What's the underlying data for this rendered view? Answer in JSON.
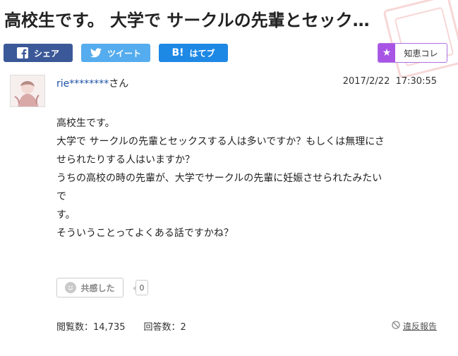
{
  "question": {
    "title": "高校生です。 大学で サークルの先輩とセック…",
    "body_lines": [
      "高校生です。",
      "大学で サークルの先輩とセックスする人は多いですか？もしくは無理にさ",
      "せられたりする人はいますか？",
      "うちの高校の時の先輩が、大学でサークルの先輩に妊娠させられたみたい",
      "で",
      "す。",
      "そういうことってよくある話ですかね？"
    ],
    "user": {
      "name": "rie********",
      "suffix": "さん"
    },
    "date": "2017/2/22  17:30:55"
  },
  "share": {
    "facebook": "シェア",
    "twitter": "ツイート",
    "hatena_mark": "B!",
    "hatena": "はてブ"
  },
  "chiekore": {
    "label": "知恵コレ"
  },
  "reaction": {
    "label": "共感した",
    "count": "0"
  },
  "stats": {
    "views": "閲覧数：14,735",
    "answers": "回答数：2"
  },
  "report": {
    "label": "違反報告"
  },
  "colors": {
    "facebook": "#3b5998",
    "twitter": "#55acee",
    "hatena": "#1e88e5",
    "chiekore": "#a855e6",
    "link": "#1a4fa3"
  },
  "icons": {
    "facebook": "facebook-icon",
    "twitter": "twitter-icon",
    "star": "star-icon",
    "smile": "smile-icon",
    "report": "prohibited-icon"
  }
}
